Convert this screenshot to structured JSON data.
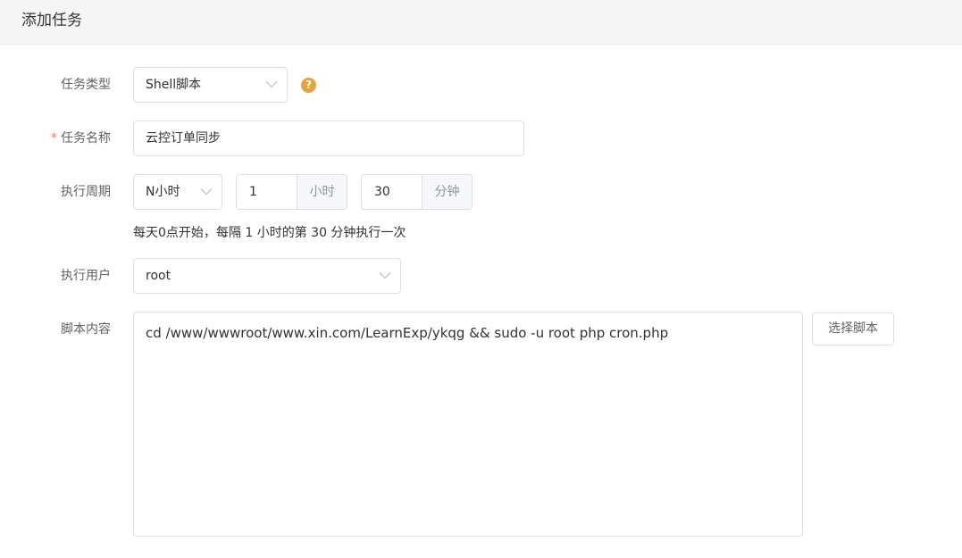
{
  "header": {
    "title": "添加任务"
  },
  "form": {
    "task_type": {
      "label": "任务类型",
      "value": "Shell脚本",
      "help": "?"
    },
    "task_name": {
      "required_mark": "*",
      "label": "任务名称",
      "value": "云控订单同步"
    },
    "cycle": {
      "label": "执行周期",
      "type_value": "N小时",
      "hours_value": "1",
      "hours_unit": "小时",
      "minutes_value": "30",
      "minutes_unit": "分钟",
      "hint": "每天0点开始，每隔 1 小时的第 30 分钟执行一次"
    },
    "user": {
      "label": "执行用户",
      "value": "root"
    },
    "script": {
      "label": "脚本内容",
      "content": "cd /www/wwwroot/www.xin.com/LearnExp/ykqg && sudo -u root php cron.php",
      "select_button": "选择脚本"
    }
  },
  "icons": {
    "dropdown": "chevron-down-icon",
    "help": "question-circle-icon"
  },
  "colors": {
    "help_icon": "#e6a23c",
    "required_mark": "#f56c6c",
    "border": "#dcdfe6",
    "addon_bg": "#f5f7fa"
  }
}
